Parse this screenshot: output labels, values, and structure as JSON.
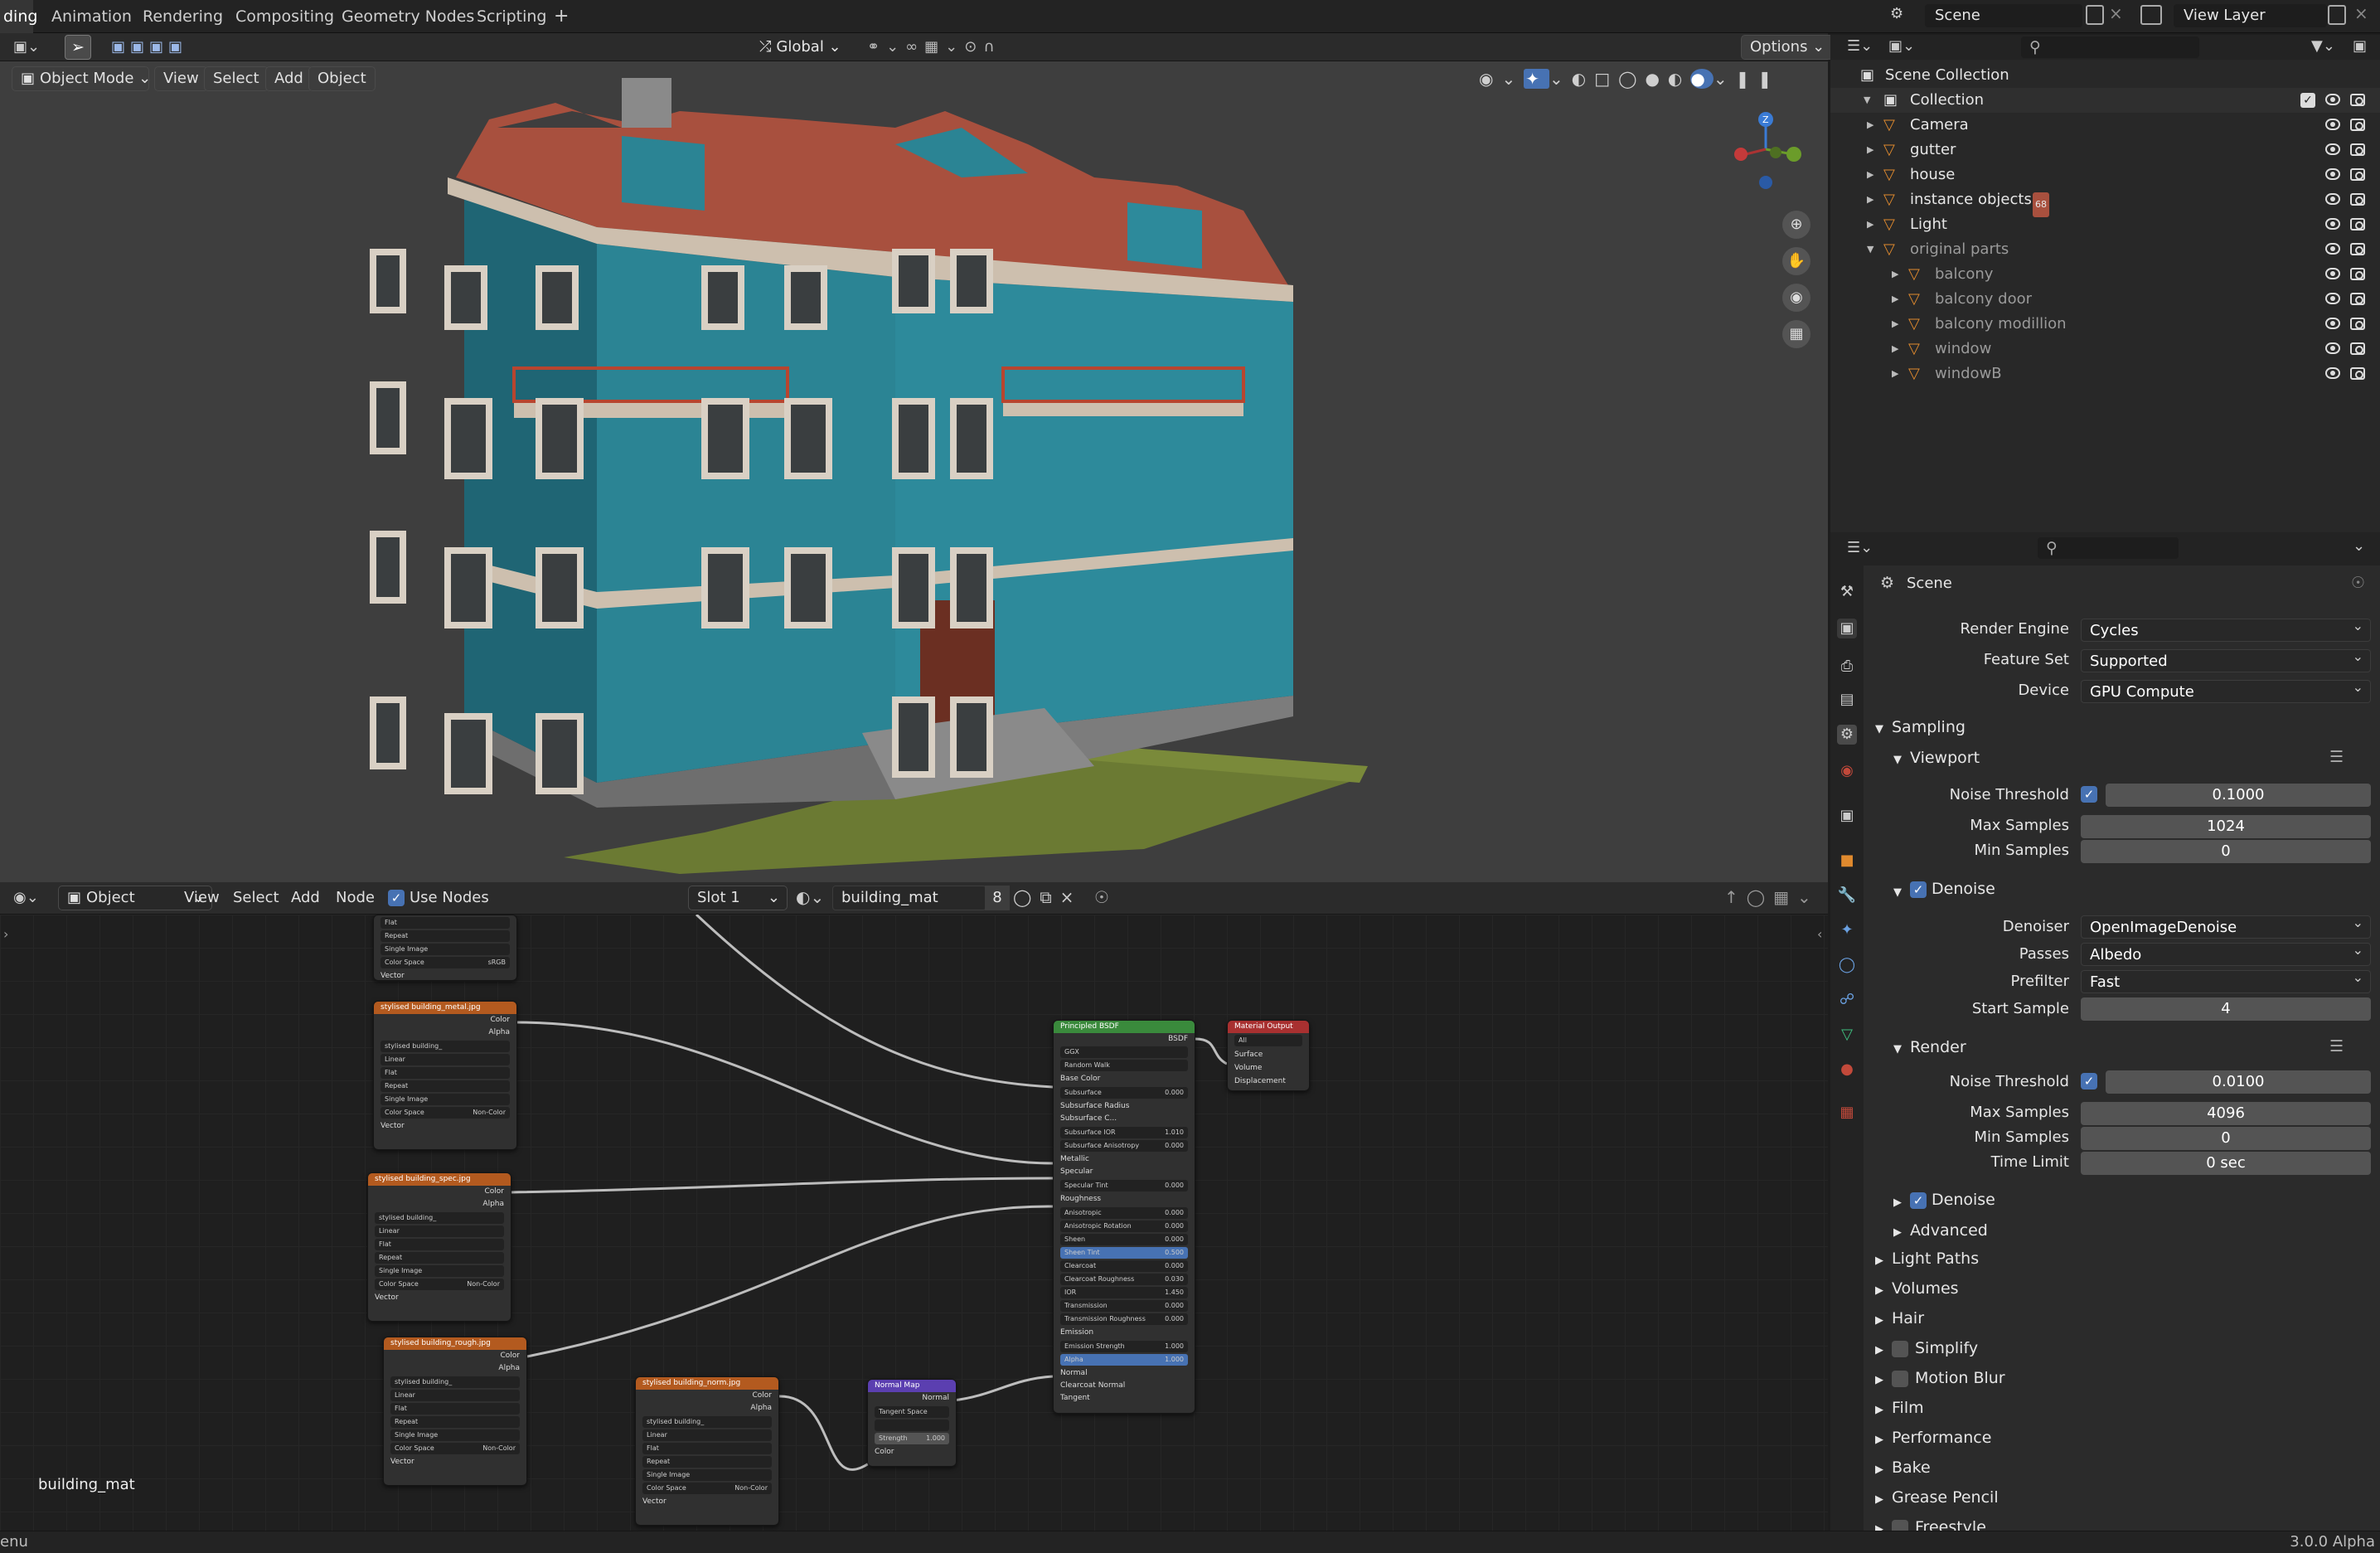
{
  "topbar": {
    "tabs": [
      "ding",
      "Animation",
      "Rendering",
      "Compositing",
      "Geometry Nodes",
      "Scripting"
    ],
    "add_tab": "+",
    "scene": "Scene",
    "view_layer": "View Layer"
  },
  "viewport": {
    "mode": "Object Mode",
    "menus": [
      "View",
      "Select",
      "Add",
      "Object"
    ],
    "orientation": "Global",
    "options": "Options",
    "gizmo_axes": [
      "Z",
      "X",
      "Y"
    ]
  },
  "node_header": {
    "editor": "Object",
    "menus": [
      "View",
      "Select",
      "Add",
      "Node"
    ],
    "use_nodes": "Use Nodes",
    "slot": "Slot 1",
    "material": "building_mat",
    "users": "8"
  },
  "node_editor": {
    "material_label": "building_mat"
  },
  "nodes": {
    "top_fragment": {
      "rows": [
        "Flat",
        "Repeat",
        "Single Image",
        "sRGB",
        "Vector"
      ],
      "color_space": "Color Space"
    },
    "metal": {
      "title": "stylised building_metal.jpg",
      "image": "stylised building_",
      "rows": [
        "Linear",
        "Flat",
        "Repeat",
        "Single Image"
      ],
      "color_space": "Color Space",
      "cs_value": "Non-Color",
      "vector": "Vector",
      "out_color": "Color",
      "out_alpha": "Alpha"
    },
    "spec": {
      "title": "stylised building_spec.jpg",
      "image": "stylised building_",
      "rows": [
        "Linear",
        "Flat",
        "Repeat",
        "Single Image"
      ],
      "color_space": "Color Space",
      "cs_value": "Non-Color",
      "vector": "Vector",
      "out_color": "Color",
      "out_alpha": "Alpha"
    },
    "rough": {
      "title": "stylised building_rough.jpg",
      "image": "stylised building_",
      "rows": [
        "Linear",
        "Flat",
        "Repeat",
        "Single Image"
      ],
      "color_space": "Color Space",
      "cs_value": "Non-Color",
      "vector": "Vector",
      "out_color": "Color",
      "out_alpha": "Alpha"
    },
    "norm": {
      "title": "stylised building_norm.jpg",
      "image": "stylised building_",
      "rows": [
        "Linear",
        "Flat",
        "Repeat",
        "Single Image"
      ],
      "color_space": "Color Space",
      "cs_value": "Non-Color",
      "vector": "Vector",
      "out_color": "Color",
      "out_alpha": "Alpha"
    },
    "normalmap": {
      "title": "Normal Map",
      "out": "Normal",
      "space": "Tangent Space",
      "strength": "Strength",
      "strength_v": "1.000",
      "color": "Color"
    },
    "bsdf": {
      "title": "Principled BSDF",
      "out": "BSDF",
      "dist": "GGX",
      "sss": "Random Walk",
      "inputs": [
        [
          "Base Color",
          ""
        ],
        [
          "Subsurface",
          "0.000"
        ],
        [
          "Subsurface Radius",
          ""
        ],
        [
          "Subsurface C...",
          ""
        ],
        [
          "Subsurface IOR",
          "1.010"
        ],
        [
          "Subsurface Anisotropy",
          "0.000"
        ],
        [
          "Metallic",
          ""
        ],
        [
          "Specular",
          ""
        ],
        [
          "Specular Tint",
          "0.000"
        ],
        [
          "Roughness",
          ""
        ],
        [
          "Anisotropic",
          "0.000"
        ],
        [
          "Anisotropic Rotation",
          "0.000"
        ],
        [
          "Sheen",
          "0.000"
        ],
        [
          "Sheen Tint",
          "0.500"
        ],
        [
          "Clearcoat",
          "0.000"
        ],
        [
          "Clearcoat Roughness",
          "0.030"
        ],
        [
          "IOR",
          "1.450"
        ],
        [
          "Transmission",
          "0.000"
        ],
        [
          "Transmission Roughness",
          "0.000"
        ],
        [
          "Emission",
          ""
        ],
        [
          "Emission Strength",
          "1.000"
        ],
        [
          "Alpha",
          "1.000"
        ],
        [
          "Normal",
          ""
        ],
        [
          "Clearcoat Normal",
          ""
        ],
        [
          "Tangent",
          ""
        ]
      ]
    },
    "output": {
      "title": "Material Output",
      "target": "All",
      "inputs": [
        "Surface",
        "Volume",
        "Displacement"
      ]
    }
  },
  "outliner": {
    "root": "Scene Collection",
    "collection": "Collection",
    "items": [
      {
        "name": "Camera",
        "dim": false,
        "indent": 1
      },
      {
        "name": "gutter",
        "dim": false,
        "indent": 1
      },
      {
        "name": "house",
        "dim": false,
        "indent": 1
      },
      {
        "name": "instance objects",
        "dim": false,
        "indent": 1,
        "badge": "68"
      },
      {
        "name": "Light",
        "dim": false,
        "indent": 1
      },
      {
        "name": "original parts",
        "dim": true,
        "indent": 1
      },
      {
        "name": "balcony",
        "dim": true,
        "indent": 2
      },
      {
        "name": "balcony door",
        "dim": true,
        "indent": 2
      },
      {
        "name": "balcony modillion",
        "dim": true,
        "indent": 2
      },
      {
        "name": "window",
        "dim": true,
        "indent": 2
      },
      {
        "name": "windowB",
        "dim": true,
        "indent": 2
      }
    ]
  },
  "properties": {
    "context": "Scene",
    "render_engine_label": "Render Engine",
    "render_engine": "Cycles",
    "feature_set_label": "Feature Set",
    "feature_set": "Supported",
    "device_label": "Device",
    "device": "GPU Compute",
    "sampling": "Sampling",
    "viewport": "Viewport",
    "noise_threshold_label": "Noise Threshold",
    "vp_noise": "0.1000",
    "max_samples_label": "Max Samples",
    "vp_max": "1024",
    "min_samples_label": "Min Samples",
    "vp_min": "0",
    "denoise": "Denoise",
    "denoiser_label": "Denoiser",
    "denoiser": "OpenImageDenoise",
    "passes_label": "Passes",
    "passes": "Albedo",
    "prefilter_label": "Prefilter",
    "prefilter": "Fast",
    "start_sample_label": "Start Sample",
    "start_sample": "4",
    "render": "Render",
    "r_noise": "0.0100",
    "r_max": "4096",
    "r_min": "0",
    "time_limit_label": "Time Limit",
    "time_limit": "0 sec",
    "advanced": "Advanced",
    "panels": [
      "Light Paths",
      "Volumes",
      "Hair",
      "Simplify",
      "Motion Blur",
      "Film",
      "Performance",
      "Bake",
      "Grease Pencil",
      "Freestyle"
    ]
  },
  "status": {
    "left": "enu",
    "version": "3.0.0 Alpha"
  },
  "colors": {
    "accent": "#4772b3",
    "teal": "#2d8a9b",
    "roof": "#a8503e",
    "texture_header": "#b35a1f",
    "bsdf_header": "#3a8a3c",
    "output_header": "#a83030",
    "normalmap_header": "#5b3fb0"
  }
}
